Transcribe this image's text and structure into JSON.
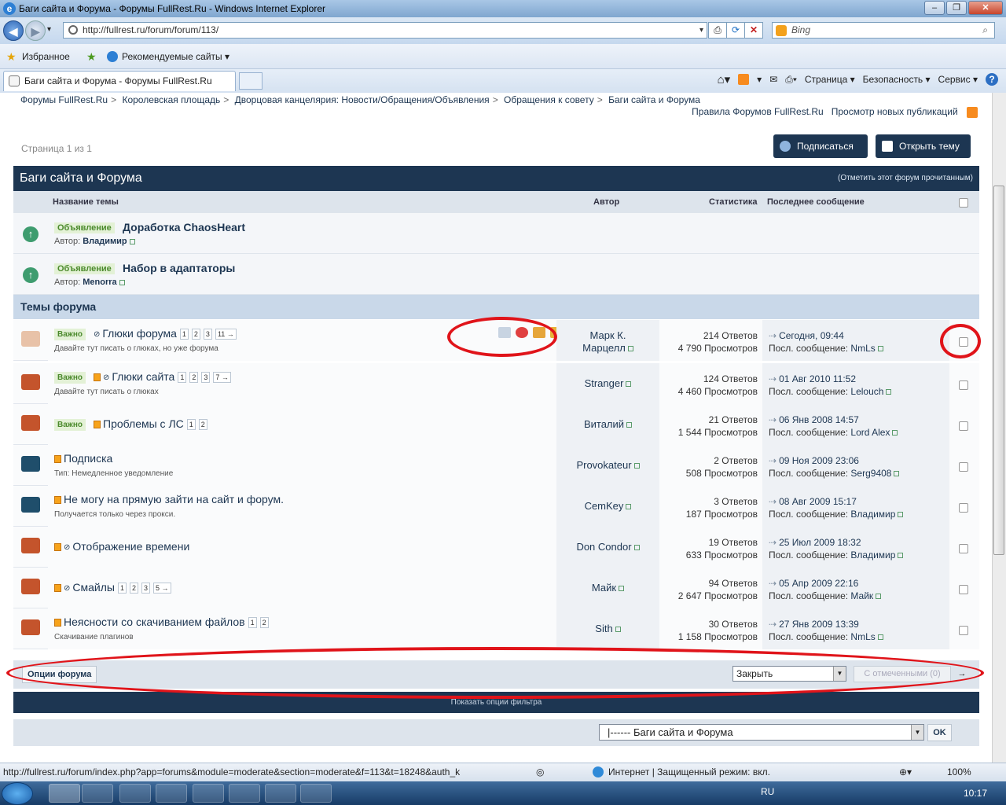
{
  "window": {
    "title": "Баги сайта и Форума - Форумы FullRest.Ru - Windows Internet Explorer",
    "url": "http://fullrest.ru/forum/forum/113/",
    "search_placeholder": "Bing"
  },
  "favorites_bar": {
    "favorites": "Избранное",
    "suggested": "Рекомендуемые сайты ▾"
  },
  "tab": {
    "title": "Баги сайта и Форума - Форумы FullRest.Ru"
  },
  "command_bar": {
    "page": "Страница ▾",
    "safety": "Безопасность ▾",
    "tools": "Сервис ▾",
    "help": "?"
  },
  "breadcrumb": [
    "Форумы FullRest.Ru",
    "Королевская площадь",
    "Дворцовая канцелярия: Новости/Обращения/Объявления",
    "Обращения к совету",
    "Баги сайта и Форума"
  ],
  "top_links": {
    "rules": "Правила Форумов FullRest.Ru",
    "new_posts": "Просмотр новых публикаций"
  },
  "page_info": "Страница 1 из 1",
  "buttons": {
    "subscribe": "Подписаться",
    "new_topic": "Открыть тему"
  },
  "forum": {
    "title": "Баги сайта и Форума",
    "mark_read": "(Отметить этот форум прочитанным)",
    "columns": {
      "topic": "Название темы",
      "author": "Автор",
      "stats": "Статистика",
      "last": "Последнее сообщение"
    }
  },
  "announcements": [
    {
      "badge": "Объявление",
      "title": "Доработка ChaosHeart",
      "author_prefix": "Автор:",
      "author": "Владимир"
    },
    {
      "badge": "Объявление",
      "title": "Набор в адаптаторы",
      "author_prefix": "Автор:",
      "author": "Menorra"
    }
  ],
  "section_title": "Темы форума",
  "topics": [
    {
      "badge": "Важно",
      "title": "Глюки форума",
      "pages": [
        "1",
        "2",
        "3",
        "11 →"
      ],
      "desc": "Давайте тут писать о глюках, но уже форума",
      "author": "Марк К. Марцелл",
      "replies": "214 Ответов",
      "views": "4 790 Просмотров",
      "last_date": "Сегодня, 09:44",
      "last_prefix": "Посл. сообщение:",
      "last_user": "NmLs",
      "icon_color": "#e8c2a8"
    },
    {
      "badge": "Важно",
      "title": "Глюки сайта",
      "pages": [
        "1",
        "2",
        "3",
        "7 →"
      ],
      "desc": "Давайте тут писать о глюках",
      "author": "Stranger",
      "replies": "124 Ответов",
      "views": "4 460 Просмотров",
      "last_date": "01 Авг 2010 11:52",
      "last_prefix": "Посл. сообщение:",
      "last_user": "Lelouch",
      "icon_color": "#c4542c"
    },
    {
      "badge": "Важно",
      "title": "Проблемы с ЛС",
      "pages": [
        "1",
        "2"
      ],
      "desc": "",
      "author": "Виталий",
      "replies": "21 Ответов",
      "views": "1 544 Просмотров",
      "last_date": "06 Янв 2008 14:57",
      "last_prefix": "Посл. сообщение:",
      "last_user": "Lord Alex",
      "icon_color": "#c4542c"
    },
    {
      "badge": "",
      "title": "Подписка",
      "pages": [],
      "desc": "Тип: Немедленное уведомление",
      "author": "Provokateur",
      "replies": "2 Ответов",
      "views": "508 Просмотров",
      "last_date": "09 Ноя 2009 23:06",
      "last_prefix": "Посл. сообщение:",
      "last_user": "Serg9408",
      "icon_color": "#1f4e6b"
    },
    {
      "badge": "",
      "title": "Не могу на прямую зайти на сайт и форум.",
      "pages": [],
      "desc": "Получается только через прокси.",
      "author": "CemKey",
      "replies": "3 Ответов",
      "views": "187 Просмотров",
      "last_date": "08 Авг 2009 15:17",
      "last_prefix": "Посл. сообщение:",
      "last_user": "Владимир",
      "icon_color": "#1f4e6b"
    },
    {
      "badge": "",
      "title": "Отображение времени",
      "pages": [],
      "desc": "",
      "author": "Don Condor",
      "replies": "19 Ответов",
      "views": "633 Просмотров",
      "last_date": "25 Июл 2009 18:32",
      "last_prefix": "Посл. сообщение:",
      "last_user": "Владимир",
      "icon_color": "#c4542c"
    },
    {
      "badge": "",
      "title": "Смайлы",
      "pages": [
        "1",
        "2",
        "3",
        "5 →"
      ],
      "desc": "",
      "author": "Майк",
      "replies": "94 Ответов",
      "views": "2 647 Просмотров",
      "last_date": "05 Апр 2009 22:16",
      "last_prefix": "Посл. сообщение:",
      "last_user": "Майк",
      "icon_color": "#c4542c"
    },
    {
      "badge": "",
      "title": "Неясности со скачиванием файлов",
      "pages": [
        "1",
        "2"
      ],
      "desc": "Скачивание плагинов",
      "author": "Sith",
      "replies": "30 Ответов",
      "views": "1 158 Просмотров",
      "last_date": "27 Янв 2009 13:39",
      "last_prefix": "Посл. сообщение:",
      "last_user": "NmLs",
      "icon_color": "#c4542c"
    }
  ],
  "options": {
    "forum_options": "Опции форума",
    "close_select": "Закрыть",
    "with_selected": "С отмеченными (0)",
    "go": "→"
  },
  "filter_toggle": "Показать опции фильтра",
  "jump": {
    "selected": "|------ Баги сайта и Форума",
    "ok": "OK"
  },
  "status_bar": {
    "url": "http://fullrest.ru/forum/index.php?app=forums&module=moderate&section=moderate&f=113&t=18248&auth_k",
    "zone": "Интернет | Защищенный режим: вкл.",
    "zoom": "100%"
  },
  "taskbar": {
    "lang": "RU",
    "time": "10:17"
  },
  "colors": {
    "brand_dark": "#1d3652",
    "annotation_red": "#e0141a",
    "badge_green": "#4b8a2c"
  }
}
